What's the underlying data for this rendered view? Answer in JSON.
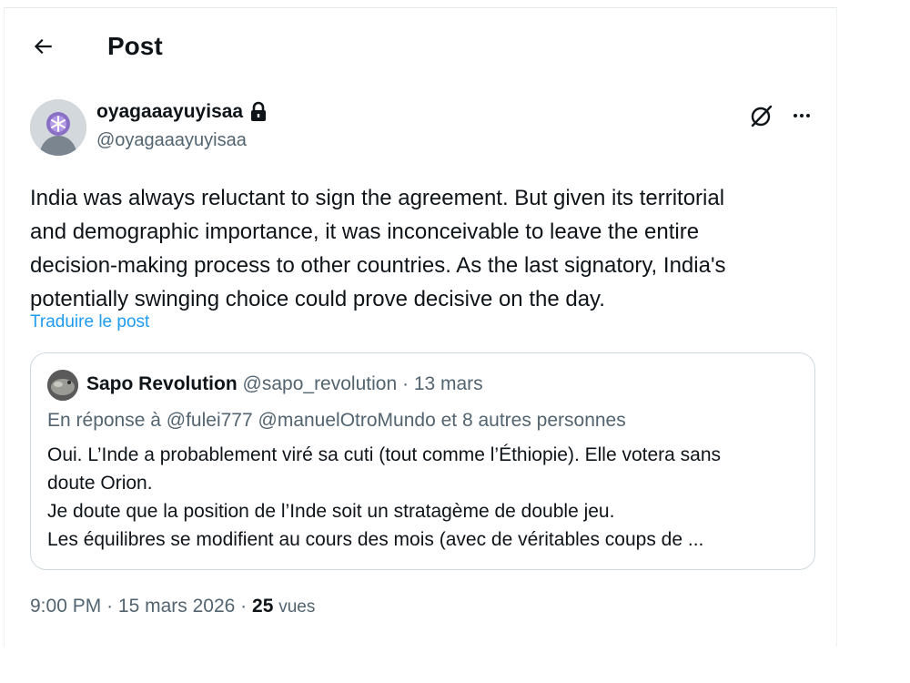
{
  "header": {
    "title": "Post",
    "back_icon": "arrow-left-icon"
  },
  "author": {
    "display_name": "oyagaaayuyisaa",
    "handle": "@oyagaaayuyisaa",
    "protected_icon": "lock-icon",
    "avatar_icon": "avatar-icon"
  },
  "actions": {
    "grok_icon": "grok-icon",
    "more_icon": "more-dots-icon"
  },
  "post": {
    "text": "India was always reluctant to sign the agreement. But given its territorial\nand demographic importance, it was inconceivable to leave the entire\ndecision-making process to other countries. As the last signatory, India's\npotentially swinging choice could prove decisive on the day.",
    "translate_label": "Traduire le post"
  },
  "quote": {
    "name": "Sapo Revolution",
    "handle": "@sapo_revolution",
    "separator": "·",
    "date": "13 mars",
    "reply_prefix": "En réponse à",
    "reply_to_1": "@fulei777",
    "reply_to_2": "@manuelOtroMundo",
    "reply_others": "et 8 autres personnes",
    "body_line_1": "Oui. L’Inde a probablement viré sa cuti (tout comme l’Éthiopie). Elle votera sans",
    "body_line_2": "doute Orion.",
    "body_line_3": "Je doute que la position de l’Inde soit un stratagème de double jeu.",
    "body_line_4": "Les équilibres se modifient au cours des mois (avec de véritables coups de ..."
  },
  "footer": {
    "time": "9:00 PM",
    "separator": "·",
    "date": "15 mars 2026",
    "views_count": "25",
    "views_label": "vues"
  },
  "colors": {
    "text_primary": "#0f1419",
    "text_secondary": "#536471",
    "link": "#1d9bf0",
    "border": "#cfd9de"
  }
}
